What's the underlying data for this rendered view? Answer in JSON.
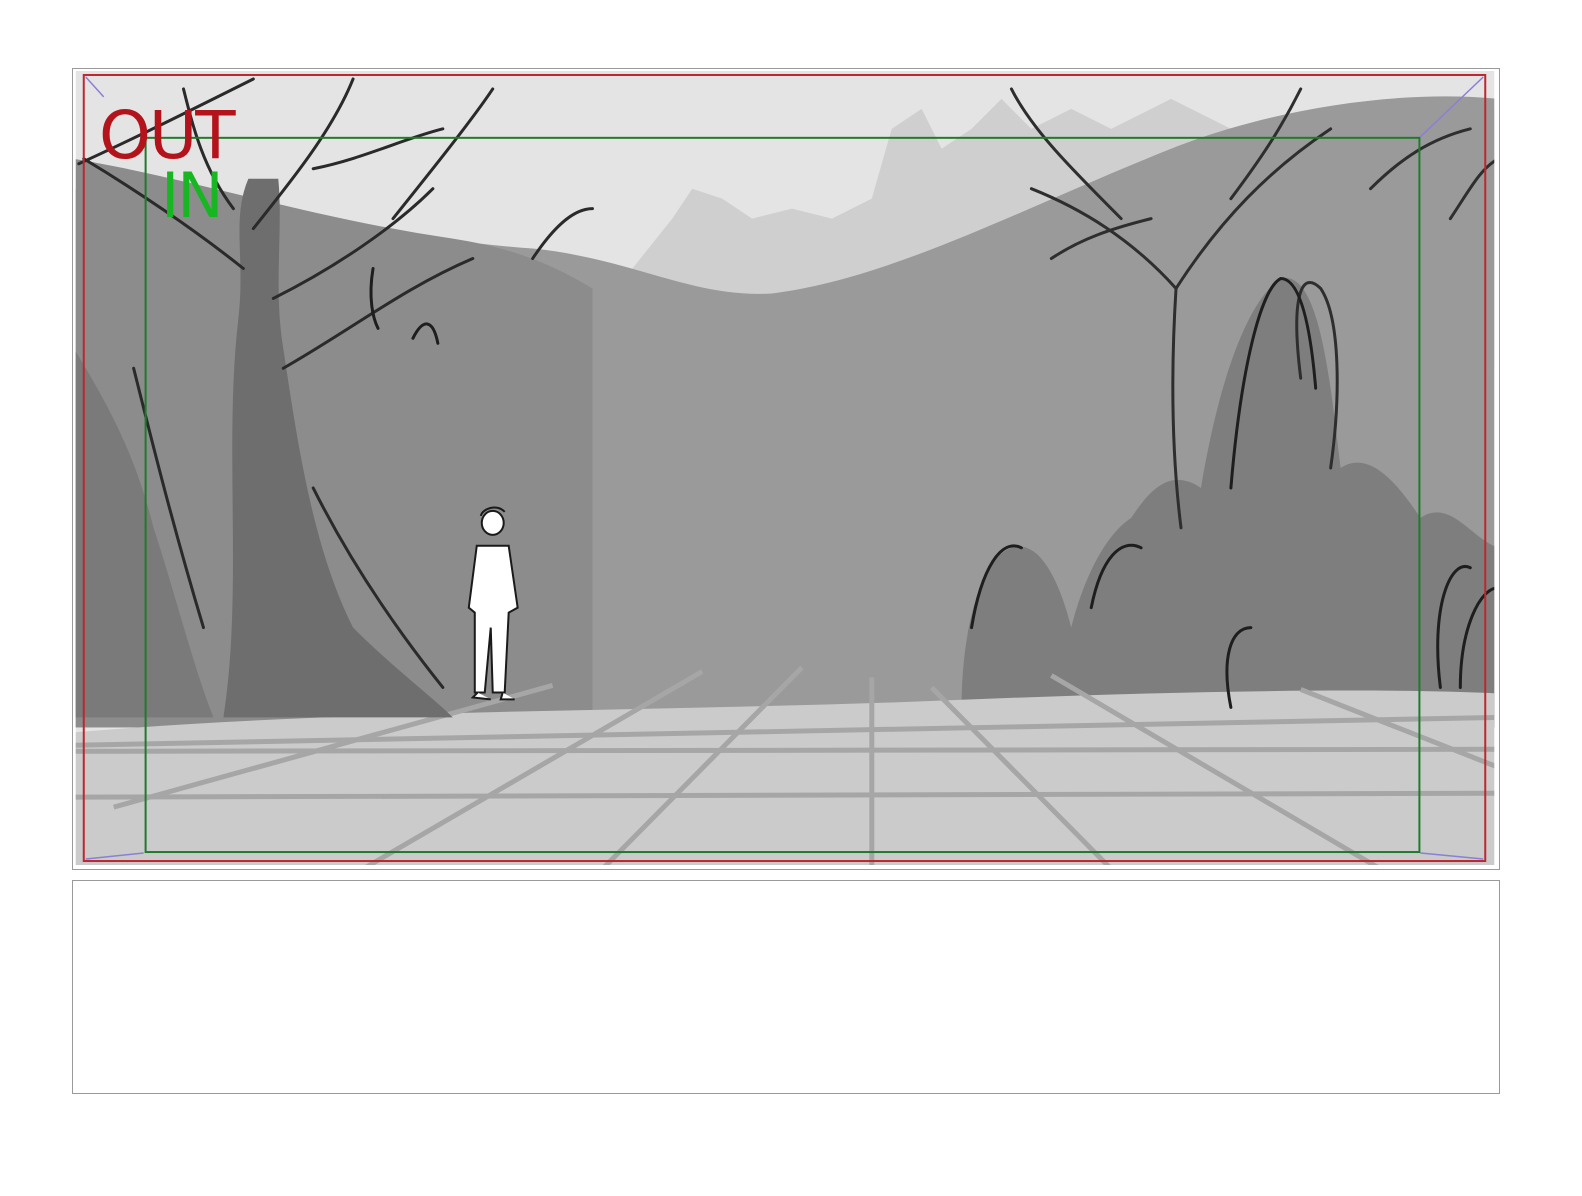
{
  "storyboard_panel": {
    "out_label": "OUT",
    "in_label": "IN",
    "out_frame_color": "#c0262f",
    "in_frame_color": "#1f7a2b",
    "out_text_color": "#b3141c",
    "in_text_color": "#19b624",
    "corner_guide_color": "#8a7fd6"
  },
  "notes": {
    "text": ""
  }
}
